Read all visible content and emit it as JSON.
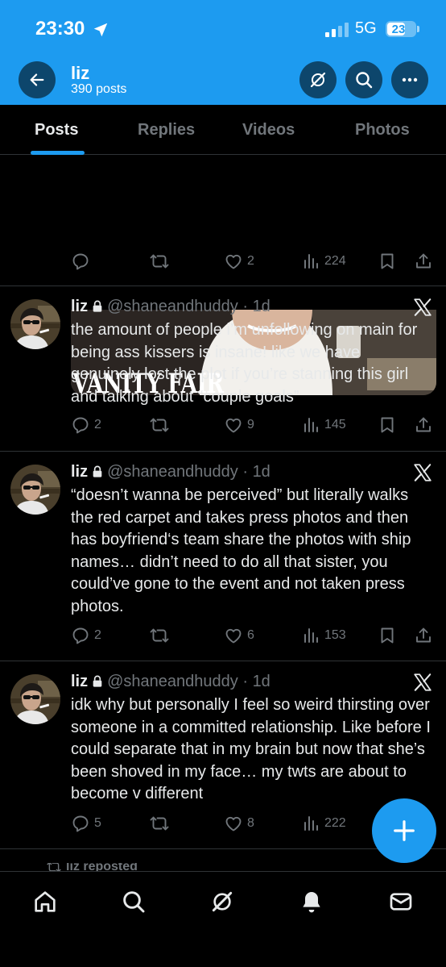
{
  "status": {
    "time": "23:30",
    "network": "5G",
    "battery": "23"
  },
  "profile": {
    "name": "liz",
    "posts": "390 posts"
  },
  "tabs": [
    {
      "label": "Posts",
      "active": true
    },
    {
      "label": "Replies",
      "active": false
    },
    {
      "label": "Videos",
      "active": false
    },
    {
      "label": "Photos",
      "active": false
    }
  ],
  "media_post": {
    "image_text": "VANITY FAIR",
    "likes": "2",
    "views": "224"
  },
  "tweets": [
    {
      "name": "liz",
      "handle": "@shaneandhuddy",
      "time": "1d",
      "text": "the amount of people i’m unfollowing on main for being ass kissers is insane! like we have genuinely lost the plot if you’re stanning this girl and talking about “couple goals”",
      "replies": "2",
      "likes": "9",
      "views": "145"
    },
    {
      "name": "liz",
      "handle": "@shaneandhuddy",
      "time": "1d",
      "text": "“doesn’t wanna be perceived” but literally walks the red carpet and takes press photos and then has boyfriend‘s team share the photos with ship names… didn’t need to do all that sister, you could’ve gone to the event and not taken press photos.",
      "replies": "2",
      "likes": "6",
      "views": "153"
    },
    {
      "name": "liz",
      "handle": "@shaneandhuddy",
      "time": "1d",
      "text": "idk why but personally I feel so weird thirsting over someone in a committed relationship. Like before I could separate that in my brain but now that she’s been shoved in my face… my twts are about to become v different",
      "replies": "5",
      "likes": "8",
      "views": "222"
    }
  ],
  "repost_label": "liz reposted",
  "colors": {
    "accent": "#1d9bf0",
    "background": "#000000",
    "muted": "#71767b",
    "text": "#e7e9ea"
  },
  "icons": [
    "back-arrow-icon",
    "grok-icon",
    "search-icon",
    "more-icon",
    "reply-icon",
    "repost-icon",
    "like-icon",
    "views-icon",
    "bookmark-icon",
    "share-icon",
    "home-icon",
    "notifications-icon",
    "messages-icon",
    "compose-icon"
  ]
}
